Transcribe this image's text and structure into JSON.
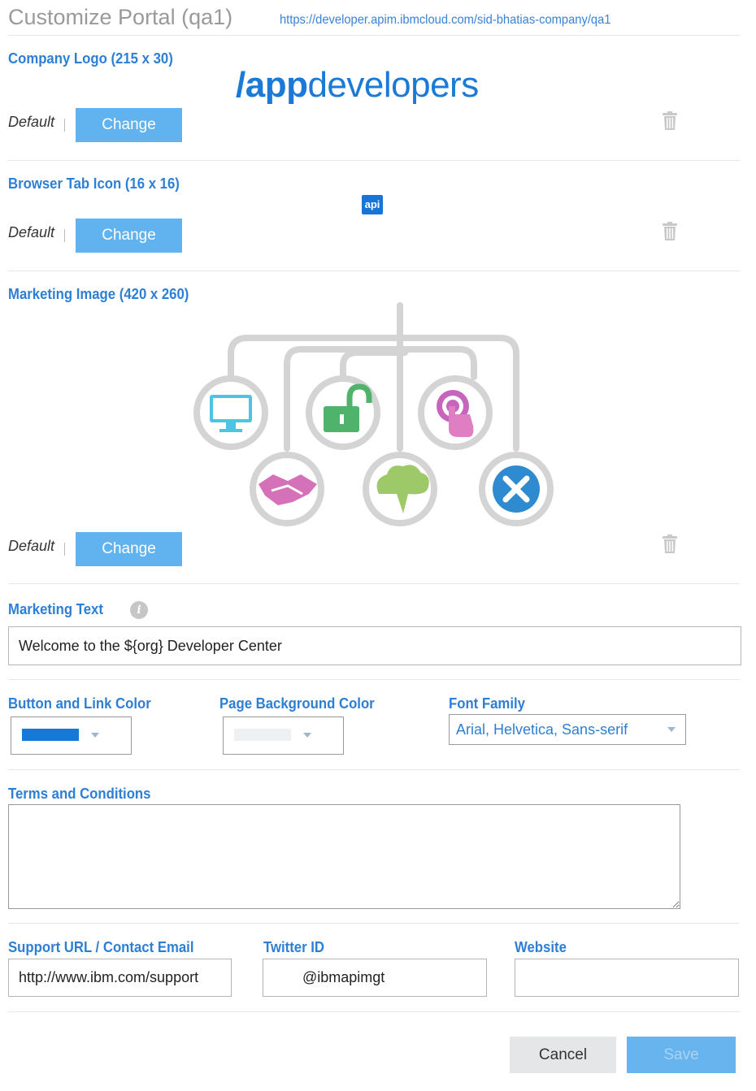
{
  "header": {
    "title": "Customize Portal (qa1)",
    "url": "https://developer.apim.ibmcloud.com/sid-bhatias-company/qa1"
  },
  "company_logo": {
    "label": "Company Logo (215 x 30)",
    "preview_prefix": "/app",
    "preview_suffix": "developers",
    "default_label": "Default",
    "change_label": "Change"
  },
  "browser_tab_icon": {
    "label": "Browser Tab Icon (16 x 16)",
    "preview_text": "api",
    "default_label": "Default",
    "change_label": "Change"
  },
  "marketing_image": {
    "label": "Marketing Image (420 x 260)",
    "default_label": "Default",
    "change_label": "Change",
    "icons": [
      "monitor-icon",
      "padlock-icon",
      "touch-icon",
      "handshake-icon",
      "cloud-icon",
      "x-icon"
    ]
  },
  "marketing_text": {
    "label": "Marketing Text",
    "value": "Welcome to the ${org} Developer Center"
  },
  "colors": {
    "button_link_label": "Button and Link Color",
    "button_link_value": "#1479d9",
    "page_background_label": "Page Background Color",
    "page_background_value": "#eef0f2"
  },
  "font_family": {
    "label": "Font Family",
    "selected": "Arial, Helvetica, Sans-serif"
  },
  "terms": {
    "label": "Terms and Conditions",
    "value": ""
  },
  "support": {
    "label": "Support URL / Contact Email",
    "value": "http://www.ibm.com/support"
  },
  "twitter": {
    "label": "Twitter ID",
    "value": "@ibmapimgt"
  },
  "website": {
    "label": "Website",
    "value": ""
  },
  "footer": {
    "cancel_label": "Cancel",
    "save_label": "Save"
  }
}
